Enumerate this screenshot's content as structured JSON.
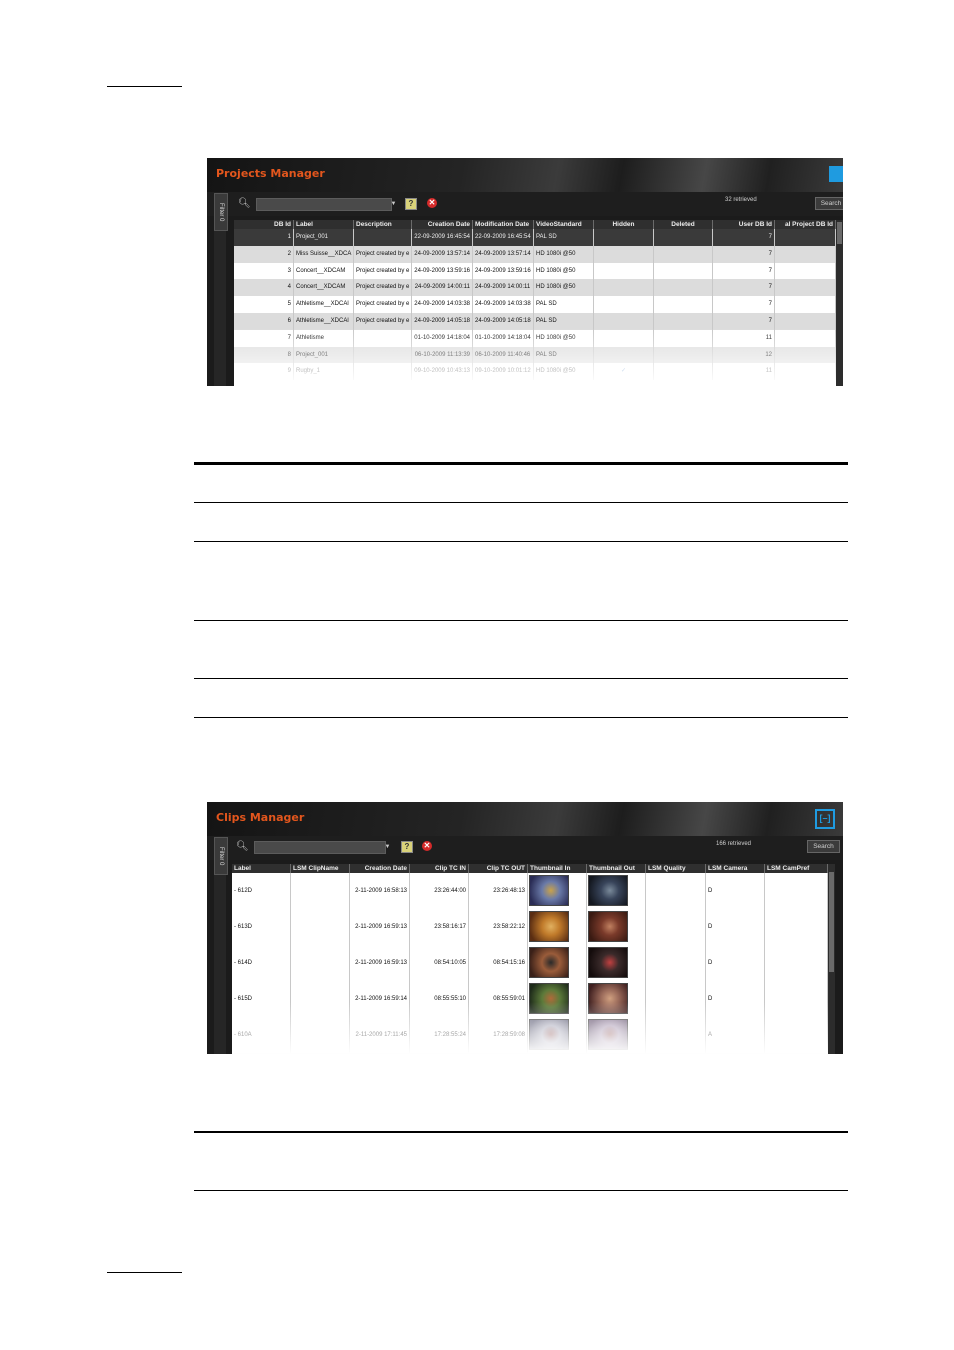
{
  "projects_window": {
    "title": "Projects Manager",
    "filter_tab": "Filter 0",
    "retrieved": "32 retrieved",
    "search_button": "Search",
    "columns": [
      "DB Id",
      "Label",
      "Description",
      "Creation Date",
      "Modification Date",
      "VideoStandard",
      "Hidden",
      "Deleted",
      "User DB Id",
      "al Project DB Id"
    ],
    "rows": [
      {
        "id": "1",
        "label": "Project_001",
        "desc": "",
        "created": "22-09-2009 16:45:54",
        "modified": "22-09-2009 16:45:54",
        "std": "PAL SD",
        "hidden": "",
        "deleted": "",
        "user": "7",
        "orig": ""
      },
      {
        "id": "2",
        "label": "Miss Suisse__XDCA",
        "desc": "Project created by e",
        "created": "24-09-2009 13:57:14",
        "modified": "24-09-2009 13:57:14",
        "std": "HD 1080i @50",
        "hidden": "",
        "deleted": "",
        "user": "7",
        "orig": ""
      },
      {
        "id": "3",
        "label": "Concert__XDCAM",
        "desc": "Project created by e",
        "created": "24-09-2009 13:59:16",
        "modified": "24-09-2009 13:59:16",
        "std": "HD 1080i @50",
        "hidden": "",
        "deleted": "",
        "user": "7",
        "orig": ""
      },
      {
        "id": "4",
        "label": "Concert__XDCAM",
        "desc": "Project created by e",
        "created": "24-09-2009 14:00:11",
        "modified": "24-09-2009 14:00:11",
        "std": "HD 1080i @50",
        "hidden": "",
        "deleted": "",
        "user": "7",
        "orig": ""
      },
      {
        "id": "5",
        "label": "Athletisme__XDCAl",
        "desc": "Project created by e",
        "created": "24-09-2009 14:03:38",
        "modified": "24-09-2009 14:03:38",
        "std": "PAL SD",
        "hidden": "",
        "deleted": "",
        "user": "7",
        "orig": ""
      },
      {
        "id": "6",
        "label": "Athletisme__XDCAl",
        "desc": "Project created by e",
        "created": "24-09-2009 14:05:18",
        "modified": "24-09-2009 14:05:18",
        "std": "PAL SD",
        "hidden": "",
        "deleted": "",
        "user": "7",
        "orig": ""
      },
      {
        "id": "7",
        "label": "Athletisme",
        "desc": "",
        "created": "01-10-2009 14:18:04",
        "modified": "01-10-2009 14:18:04",
        "std": "HD 1080i @50",
        "hidden": "",
        "deleted": "",
        "user": "11",
        "orig": ""
      },
      {
        "id": "8",
        "label": "Project_001",
        "desc": "",
        "created": "06-10-2009 11:13:39",
        "modified": "06-10-2009 11:40:46",
        "std": "PAL SD",
        "hidden": "",
        "deleted": "",
        "user": "12",
        "orig": ""
      },
      {
        "id": "9",
        "label": "Rugby_1",
        "desc": "",
        "created": "09-10-2009 10:43:13",
        "modified": "09-10-2009 10:01:12",
        "std": "HD 1080i @50",
        "hidden": "✓",
        "deleted": "",
        "user": "11",
        "orig": ""
      }
    ]
  },
  "clips_window": {
    "title": "Clips Manager",
    "filter_tab": "Filter 0",
    "retrieved": "166 retrieved",
    "search_button": "Search",
    "logo_glyph": "[–]",
    "columns": [
      "Label",
      "LSM ClipName",
      "Creation Date",
      "Clip TC IN",
      "Clip TC OUT",
      "Thumbnail In",
      "Thumbnail Out",
      "LSM Quality",
      "LSM Camera",
      "LSM CamPref"
    ],
    "rows": [
      {
        "label": "- 612D",
        "clipname": "",
        "created": "2-11-2009 16:58:13",
        "tcin": "23:26:44:00",
        "tcout": "23:26:48:13",
        "quality": "",
        "camera": "D",
        "campref": ""
      },
      {
        "label": "- 613D",
        "clipname": "",
        "created": "2-11-2009 16:59:13",
        "tcin": "23:58:16:17",
        "tcout": "23:58:22:12",
        "quality": "",
        "camera": "D",
        "campref": ""
      },
      {
        "label": "- 614D",
        "clipname": "",
        "created": "2-11-2009 16:59:13",
        "tcin": "08:54:10:05",
        "tcout": "08:54:15:16",
        "quality": "",
        "camera": "D",
        "campref": ""
      },
      {
        "label": "- 615D",
        "clipname": "",
        "created": "2-11-2009 16:59:14",
        "tcin": "08:55:55:10",
        "tcout": "08:55:59:01",
        "quality": "",
        "camera": "D",
        "campref": ""
      },
      {
        "label": "- 610A",
        "clipname": "",
        "created": "2-11-2009 17:11:45",
        "tcin": "17:28:55:24",
        "tcout": "17:28:59:08",
        "quality": "",
        "camera": "A",
        "campref": ""
      }
    ]
  },
  "colors": {
    "title_orange": "#e3561d",
    "logo_blue": "#1f9be0",
    "header_dark": "#2f2f2f",
    "row_alt": "#dcdcdc",
    "row_selected": "#3a3a3a"
  }
}
